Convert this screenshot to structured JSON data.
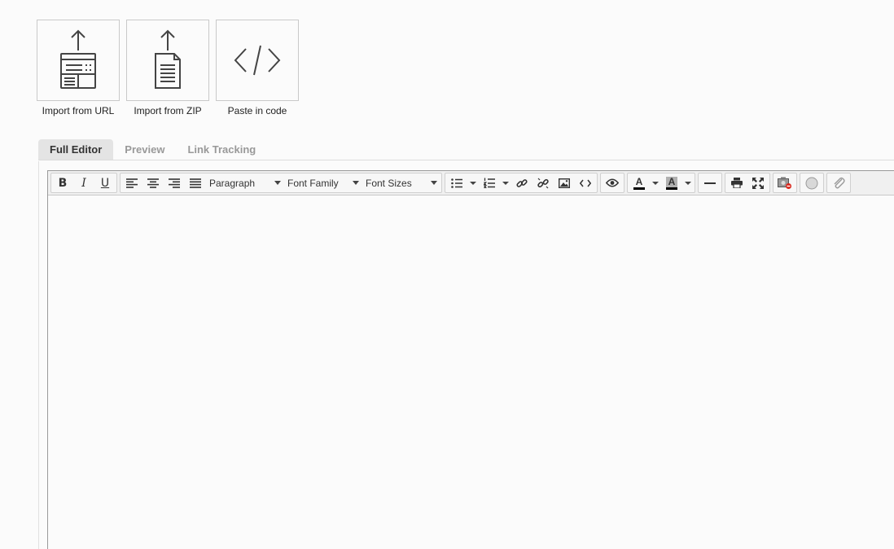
{
  "import_options": [
    {
      "label": "Import from URL",
      "icon": "import-url-icon"
    },
    {
      "label": "Import from ZIP",
      "icon": "import-zip-icon"
    },
    {
      "label": "Paste in code",
      "icon": "code-icon"
    }
  ],
  "tabs": {
    "full_editor": "Full Editor",
    "preview": "Preview",
    "link_tracking": "Link Tracking",
    "active": "Full Editor"
  },
  "toolbar": {
    "bold": "B",
    "italic": "I",
    "underline": "U",
    "block_format": "Paragraph",
    "font_family": "Font Family",
    "font_size": "Font Sizes",
    "text_color_label": "A",
    "bg_color_label": "A"
  },
  "colors": {
    "text_color_underline": "#000000",
    "bg_color_fill": "#b0b0b0"
  },
  "editor": {
    "content": ""
  }
}
